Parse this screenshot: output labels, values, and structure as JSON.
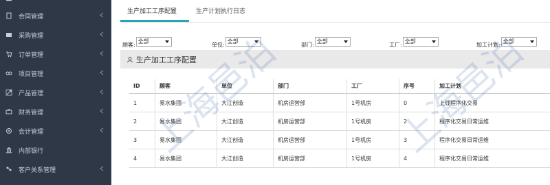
{
  "sidebar": {
    "items": [
      {
        "label": "",
        "icon": "menu-icon"
      },
      {
        "label": "合同管理",
        "icon": "contract-icon"
      },
      {
        "label": "采购管理",
        "icon": "purchase-icon"
      },
      {
        "label": "订单管理",
        "icon": "cart-icon"
      },
      {
        "label": "项目管理",
        "icon": "project-icon"
      },
      {
        "label": "产品管理",
        "icon": "product-icon"
      },
      {
        "label": "财务管理",
        "icon": "finance-icon"
      },
      {
        "label": "会计管理",
        "icon": "accounting-icon"
      },
      {
        "label": "内部银行",
        "icon": "bank-icon"
      },
      {
        "label": "客户关系管理",
        "icon": "crm-icon"
      }
    ]
  },
  "tabs": [
    {
      "label": "生产加工工序配置",
      "active": true
    },
    {
      "label": "生产计划执行日志",
      "active": false
    }
  ],
  "filters": [
    {
      "label": "顾客:",
      "value": "全部"
    },
    {
      "label": "单位:",
      "value": "全部"
    },
    {
      "label": "部门:",
      "value": "全部"
    },
    {
      "label": "工厂:",
      "value": "全部"
    },
    {
      "label": "加工计划:",
      "value": "全部"
    }
  ],
  "section": {
    "title": "生产加工工序配置"
  },
  "table": {
    "columns": [
      "ID",
      "顾客",
      "单位",
      "部门",
      "工厂",
      "序号",
      "加工计划"
    ],
    "rows": [
      [
        "1",
        "易水集团",
        "大江创造",
        "机房运营部",
        "1号机房",
        "0",
        "上线程序化交易"
      ],
      [
        "2",
        "易水集团",
        "大江创造",
        "机房运营部",
        "1号机房",
        "2",
        "程序化交易日常运维"
      ],
      [
        "3",
        "易水集团",
        "大江创造",
        "机房运营部",
        "1号机房",
        "3",
        "程序化交易日常运维"
      ],
      [
        "4",
        "易水集团",
        "大江创造",
        "机房运营部",
        "1号机房",
        "4",
        "程序化交易日常运维"
      ]
    ]
  },
  "watermark": {
    "text": "上海邑泊"
  },
  "colors": {
    "sidebar_bg": "#2f3847",
    "accent": "#25a5b5",
    "section_bg": "#e9e9e9"
  }
}
